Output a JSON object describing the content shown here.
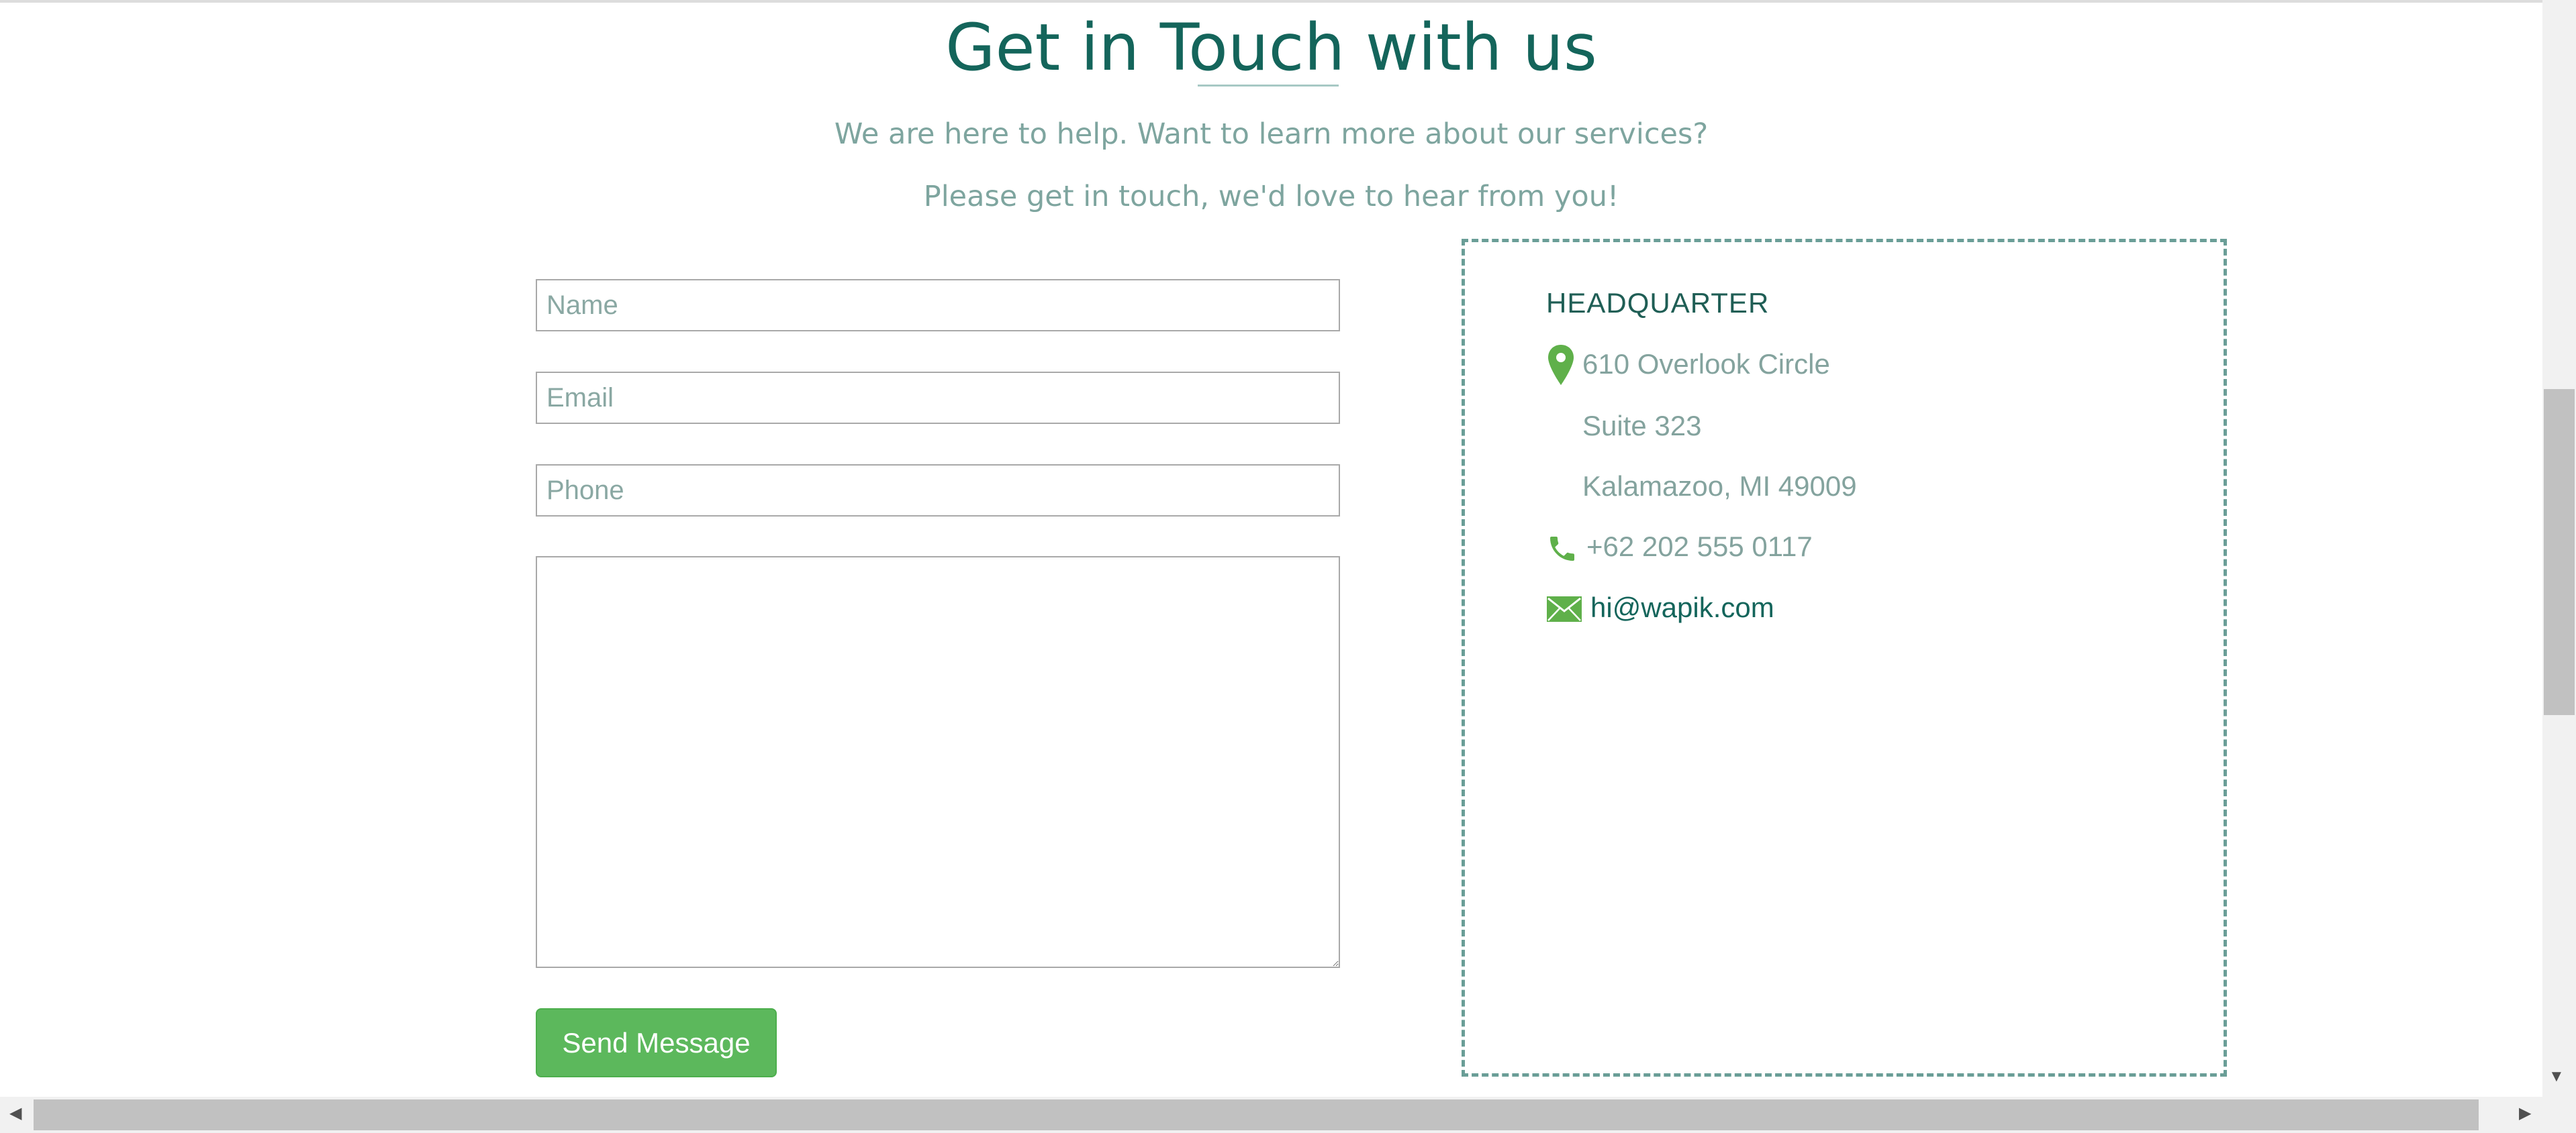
{
  "header": {
    "title": "Get in Touch with us",
    "subtitle_line1": "We are here to help. Want to learn more about our services?",
    "subtitle_line2": "Please get in touch, we'd love to hear from you!"
  },
  "form": {
    "name_placeholder": "Name",
    "email_placeholder": "Email",
    "phone_placeholder": "Phone",
    "message_placeholder": "",
    "submit_label": "Send Message"
  },
  "headquarter": {
    "title": "HEADQUARTER",
    "address_line1": "610 Overlook Circle",
    "address_line2": "Suite 323",
    "address_line3": "Kalamazoo, MI 49009",
    "phone": "+62 202 555 0117",
    "email": "hi@wapik.com",
    "icons": [
      "map-pin-icon",
      "phone-icon",
      "envelope-icon"
    ]
  },
  "colors": {
    "heading": "#14655b",
    "muted_text": "#84a39e",
    "accent_green": "#5cb85c",
    "card_border": "#6a9e97"
  }
}
